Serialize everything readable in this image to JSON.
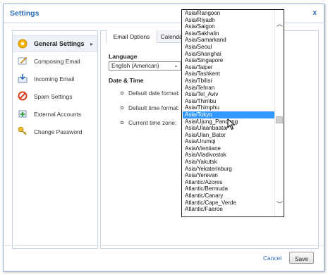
{
  "dialog": {
    "title": "Settings",
    "close_label": "x"
  },
  "sidebar": {
    "items": [
      {
        "label": "General Settings",
        "icon": "gear-icon",
        "active": true
      },
      {
        "label": "Composing Email",
        "icon": "compose-icon"
      },
      {
        "label": "Incoming Email",
        "icon": "inbox-icon"
      },
      {
        "label": "Spam Settings",
        "icon": "spam-block-icon"
      },
      {
        "label": "External Accounts",
        "icon": "add-account-icon"
      },
      {
        "label": "Change Password",
        "icon": "key-icon"
      }
    ],
    "arrow": "▸"
  },
  "tabs": [
    {
      "label": "Email Options",
      "active": true
    },
    {
      "label": "Calendar",
      "active": false
    }
  ],
  "language": {
    "heading": "Language",
    "selected": "English (American)"
  },
  "date_time": {
    "heading": "Date & Time",
    "fields": [
      {
        "label": "Default date format:"
      },
      {
        "label": "Default time format:"
      },
      {
        "label": "Current time zone:"
      }
    ]
  },
  "timezone_list": {
    "selected": "Asia/Tokyo",
    "items": [
      "Asia/Rangoon",
      "Asia/Riyadh",
      "Asia/Saigon",
      "Asia/Sakhalin",
      "Asia/Samarkand",
      "Asia/Seoul",
      "Asia/Shanghai",
      "Asia/Singapore",
      "Asia/Taipei",
      "Asia/Tashkent",
      "Asia/Tbilisi",
      "Asia/Tehran",
      "Asia/Tel_Aviv",
      "Asia/Thimbu",
      "Asia/Thimphu",
      "Asia/Tokyo",
      "Asia/Ujung_Pandang",
      "Asia/Ulaanbaatar",
      "Asia/Ulan_Bator",
      "Asia/Urumqi",
      "Asia/Vientiane",
      "Asia/Vladivostok",
      "Asia/Yakutsk",
      "Asia/Yekaterinburg",
      "Asia/Yerevan",
      "Atlantic/Azores",
      "Atlantic/Bermuda",
      "Atlantic/Canary",
      "Atlantic/Cape_Verde",
      "Atlantic/Faeroe"
    ]
  },
  "footer": {
    "cancel_label": "Cancel",
    "save_label": "Save"
  },
  "colors": {
    "accent": "#2b6cb6",
    "selection": "#3399ff"
  }
}
